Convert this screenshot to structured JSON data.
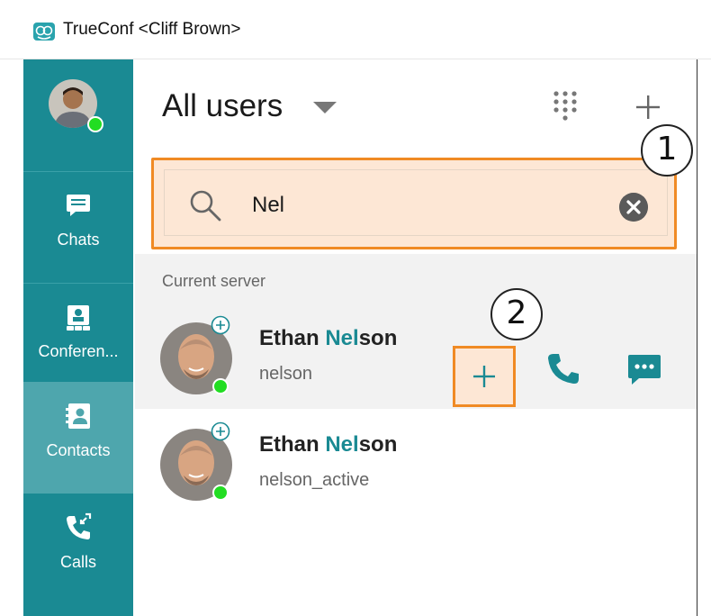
{
  "window": {
    "title": "TrueConf <Cliff Brown>"
  },
  "sidebar": {
    "items": [
      {
        "label": "Chats",
        "icon": "chat-bubble-icon"
      },
      {
        "label": "Conferen...",
        "icon": "conference-icon"
      },
      {
        "label": "Contacts",
        "icon": "contacts-icon",
        "active": true
      },
      {
        "label": "Calls",
        "icon": "calls-icon"
      }
    ]
  },
  "header": {
    "title": "All users"
  },
  "search": {
    "value": "Nel"
  },
  "annotations": {
    "badge1": "1",
    "badge2": "2"
  },
  "results": {
    "section_label": "Current server",
    "rows": [
      {
        "name_prefix": "Ethan ",
        "name_match": "Nel",
        "name_suffix": "son",
        "login": "nelson"
      },
      {
        "name_prefix": "Ethan ",
        "name_match": "Nel",
        "name_suffix": "son",
        "login": "nelson_active"
      }
    ]
  },
  "colors": {
    "accent": "#1a8a93",
    "sidebar_active": "#4ea6ad",
    "highlight": "#f08a24",
    "highlight_fill": "#fde7d5",
    "presence_online": "#22dd22"
  }
}
